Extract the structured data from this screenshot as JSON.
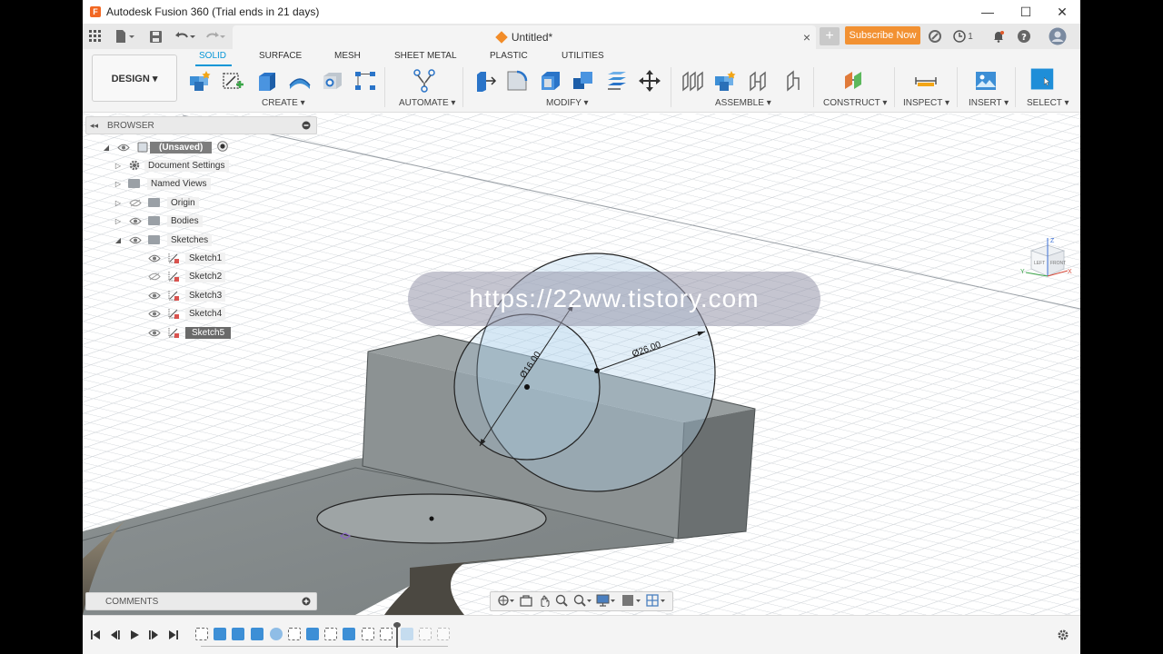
{
  "window": {
    "title": "Autodesk Fusion 360 (Trial ends in 21 days)",
    "logo_letter": "F",
    "minimize": "—",
    "maximize": "☐",
    "close": "✕"
  },
  "tabbar": {
    "doc_title": "Untitled*",
    "close": "×",
    "new_tab": "+",
    "subscribe_label": "Subscribe Now",
    "jobs_count": "1"
  },
  "ribbon": {
    "workspace_label": "DESIGN ▾",
    "tabs": [
      "SOLID",
      "SURFACE",
      "MESH",
      "SHEET METAL",
      "PLASTIC",
      "UTILITIES"
    ],
    "active_tab": "SOLID",
    "groups": [
      "CREATE ▾",
      "AUTOMATE ▾",
      "MODIFY ▾",
      "ASSEMBLE ▾",
      "CONSTRUCT ▾",
      "INSPECT ▾",
      "INSERT ▾",
      "SELECT ▾"
    ]
  },
  "browser": {
    "title": "BROWSER",
    "items": [
      {
        "label": "(Unsaved)"
      },
      {
        "label": "Document Settings"
      },
      {
        "label": "Named Views"
      },
      {
        "label": "Origin"
      },
      {
        "label": "Bodies"
      },
      {
        "label": "Sketches"
      },
      {
        "label": "Sketch1"
      },
      {
        "label": "Sketch2"
      },
      {
        "label": "Sketch3"
      },
      {
        "label": "Sketch4"
      },
      {
        "label": "Sketch5"
      }
    ]
  },
  "comments": {
    "title": "COMMENTS",
    "add": "+"
  },
  "viewport": {
    "dim_small": "Ø16.00",
    "dim_large": "Ø26.00",
    "watermark": "https://22ww.tistory.com",
    "viewcube": {
      "left": "LEFT",
      "front": "FRONT",
      "z": "Z",
      "x": "X",
      "y": "Y"
    }
  },
  "colors": {
    "accent": "#0696d7",
    "subscribe": "#f29132",
    "body": "#8e9191"
  }
}
